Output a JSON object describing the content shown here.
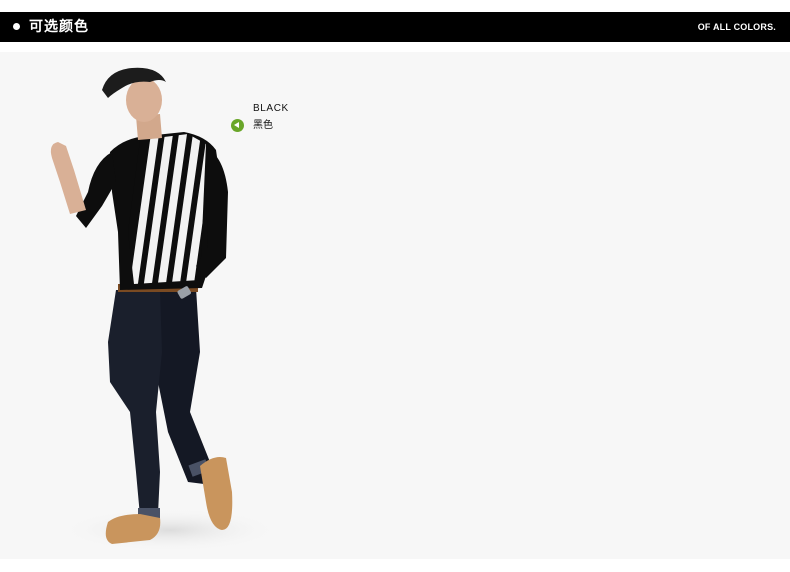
{
  "header": {
    "title": "可选颜色",
    "subtitle": "OF ALL COLORS."
  },
  "colors": [
    {
      "name_en": "BLACK",
      "name_zh": "黑色",
      "arrow_color": "#6aa629",
      "arrow_icon": "arrow-left-circle-icon"
    }
  ],
  "theme": {
    "header_bg": "#000000",
    "header_text": "#ffffff",
    "stage_bg": "#f7f7f7"
  }
}
